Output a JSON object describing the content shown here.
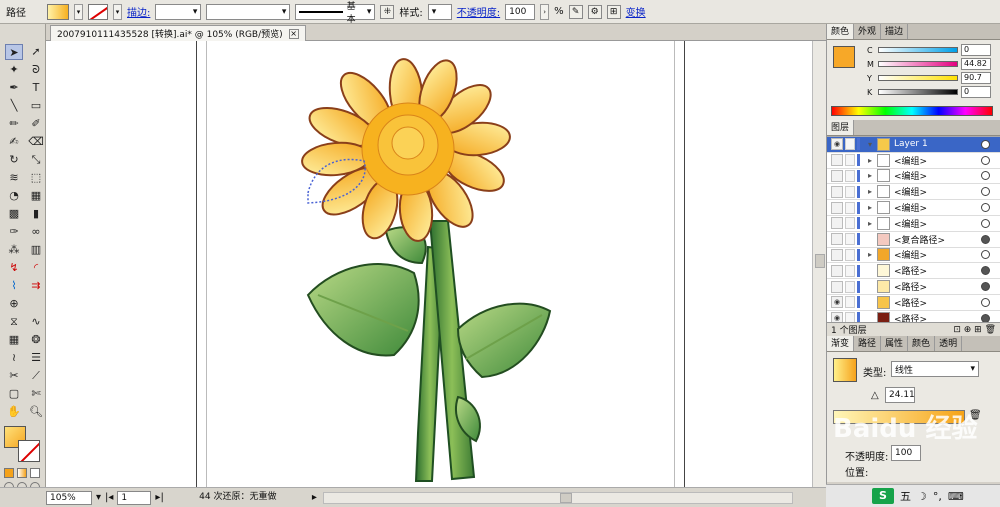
{
  "control_bar": {
    "object_type": "路径",
    "stroke_link": "描边:",
    "line_style_label": "基本",
    "style_label": "样式:",
    "opacity_link": "不透明度:",
    "opacity_value": "100",
    "percent": "%",
    "transform_link": "变换"
  },
  "document": {
    "tab_title": "2007910111435528 [转换].ai* @ 105% (RGB/预览)"
  },
  "status": {
    "zoom": "105%",
    "artboard": "1",
    "info": "44 次还原：无重做"
  },
  "panels": {
    "color_tabs": [
      "颜色",
      "外观",
      "描边"
    ],
    "color": {
      "accent": "#F7A828",
      "c": "0",
      "m": "44.82",
      "y": "90.7",
      "k": "0"
    },
    "layers_tab": "图层",
    "layers": [
      {
        "label": "Layer 1",
        "kind": "layer"
      },
      {
        "label": "<编组>",
        "kind": "group"
      },
      {
        "label": "<编组>",
        "kind": "group"
      },
      {
        "label": "<编组>",
        "kind": "group"
      },
      {
        "label": "<编组>",
        "kind": "group"
      },
      {
        "label": "<编组>",
        "kind": "group"
      },
      {
        "label": "<复合路径>",
        "kind": "compound"
      },
      {
        "label": "<编组>",
        "kind": "group"
      },
      {
        "label": "<路径>",
        "kind": "path"
      },
      {
        "label": "<路径>",
        "kind": "path"
      },
      {
        "label": "<路径>",
        "kind": "path"
      },
      {
        "label": "<路径>",
        "kind": "path"
      }
    ],
    "layers_count": "1 个图层",
    "gradient_tabs": [
      "渐变",
      "路径",
      "属性",
      "颜色",
      "透明"
    ],
    "gradient": {
      "type_label": "类型:",
      "type_value": "线性",
      "angle": "24.11",
      "opacity_label": "不透明度:",
      "opacity_value": "100",
      "location_label": "位置:"
    },
    "watermark": "Baidu 经验"
  },
  "taskbar": {
    "ime": "五"
  }
}
